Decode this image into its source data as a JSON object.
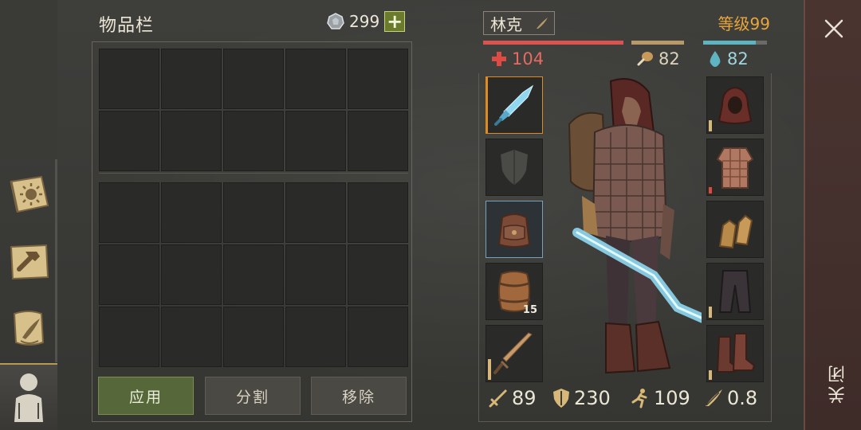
{
  "inventory": {
    "title": "物品栏",
    "currency": "299",
    "buttons": {
      "apply": "应用",
      "split": "分割",
      "remove": "移除"
    }
  },
  "character": {
    "name": "林克",
    "level": "等级99",
    "stats": {
      "health": "104",
      "food": "82",
      "water": "82"
    },
    "bottom_stats": {
      "attack": "89",
      "defense": "230",
      "speed": "109",
      "weight": "0.8"
    },
    "slots": {
      "ammo_count": "15"
    }
  },
  "close": {
    "label": "关闭"
  },
  "colors": {
    "health": "#d9534f",
    "food": "#b89a6a",
    "water": "#5fb4c2",
    "level": "#e8a63c",
    "accent": "#e08a22"
  }
}
